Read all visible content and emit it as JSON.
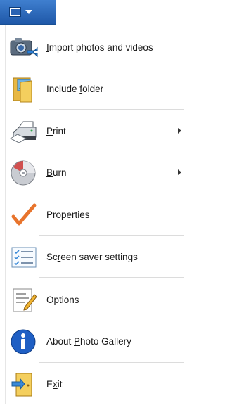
{
  "menu_button": {
    "icon": "menu-list-icon",
    "caret": "caret-down-icon",
    "color": "#2a63b3"
  },
  "items": [
    {
      "id": "import",
      "pre": "",
      "key": "I",
      "post": "mport photos and videos",
      "icon": "camera-import-icon",
      "submenu": false
    },
    {
      "id": "include-folder",
      "pre": "Include ",
      "key": "f",
      "post": "older",
      "icon": "folder-picture-icon",
      "submenu": false
    },
    {
      "id": "print",
      "pre": "",
      "key": "P",
      "post": "rint",
      "icon": "printer-icon",
      "submenu": true
    },
    {
      "id": "burn",
      "pre": "",
      "key": "B",
      "post": "urn",
      "icon": "disc-burn-icon",
      "submenu": true
    },
    {
      "id": "properties",
      "pre": "Prop",
      "key": "e",
      "post": "rties",
      "icon": "checkmark-icon",
      "submenu": false
    },
    {
      "id": "screen-saver",
      "pre": "Sc",
      "key": "r",
      "post": "een saver settings",
      "icon": "list-checklist-icon",
      "submenu": false
    },
    {
      "id": "options",
      "pre": "",
      "key": "O",
      "post": "ptions",
      "icon": "notepad-pencil-icon",
      "submenu": false
    },
    {
      "id": "about",
      "pre": "About ",
      "key": "P",
      "post": "hoto Gallery",
      "icon": "info-icon",
      "submenu": false
    },
    {
      "id": "exit",
      "pre": "E",
      "key": "x",
      "post": "it",
      "icon": "exit-door-icon",
      "submenu": false
    }
  ]
}
